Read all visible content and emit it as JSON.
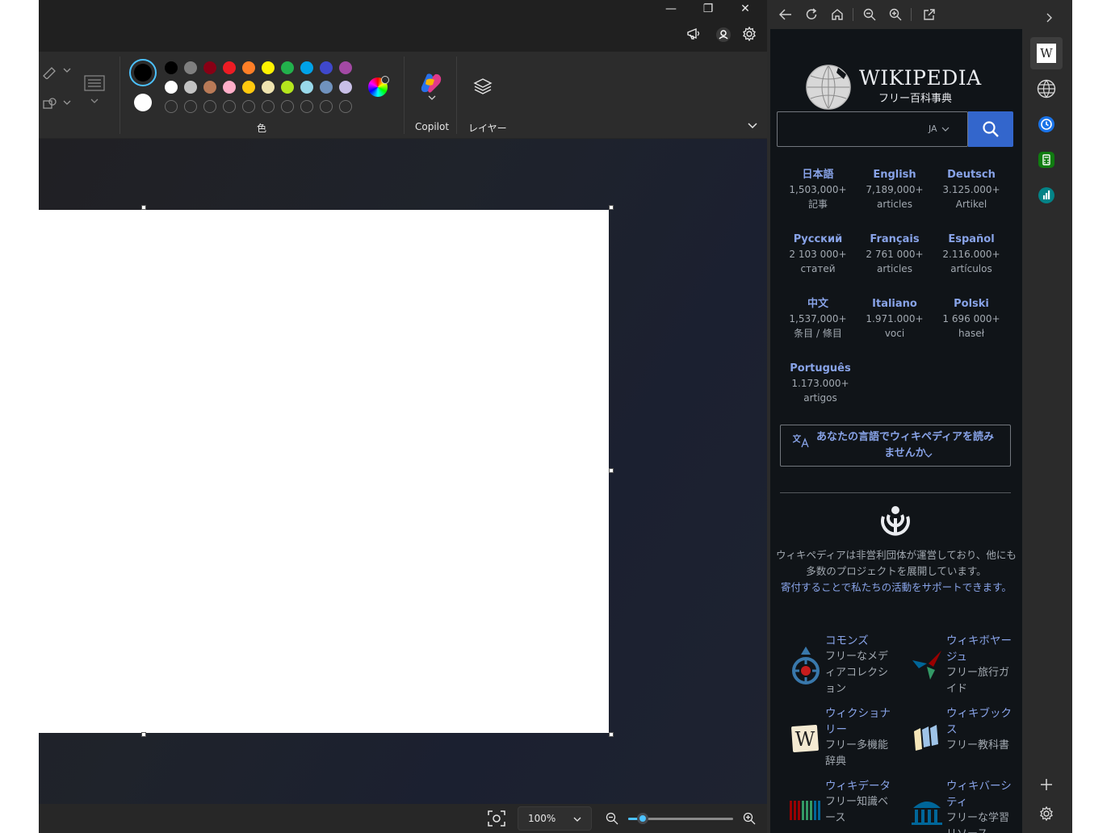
{
  "paint": {
    "window_controls": {
      "minimize": "—",
      "restore": "❐",
      "close": "✕"
    },
    "titlebar_icons": [
      "megaphone-icon",
      "account-icon",
      "settings-gear-icon"
    ],
    "palette": {
      "primary_color": "#000000",
      "secondary_color": "#ffffff",
      "row1": [
        "#000000",
        "#7f7f7f",
        "#880015",
        "#ed1c24",
        "#ff7f27",
        "#fff200",
        "#22b14c",
        "#00a2e8",
        "#3f48cc",
        "#a349a4"
      ],
      "row2": [
        "#ffffff",
        "#c3c3c3",
        "#b97a57",
        "#ffaec9",
        "#ffc90e",
        "#efe4b0",
        "#b5e61d",
        "#99d9ea",
        "#7092be",
        "#c8bfe7"
      ],
      "label": "色"
    },
    "copilot_label": "Copilot",
    "layers_label": "レイヤー",
    "status": {
      "zoom_value": "100%",
      "zoom_percent": 10
    }
  },
  "sidepanel": {
    "toolbar_icons": [
      "back-icon",
      "refresh-icon",
      "home-icon",
      "zoom-out-icon",
      "zoom-in-icon",
      "open-external-icon"
    ],
    "wiki": {
      "wordmark": "WIKIPEDIA",
      "tagline": "フリー百科事典",
      "search": {
        "placeholder": "",
        "lang_code": "JA"
      },
      "languages": [
        {
          "name": "日本語",
          "count": "1,503,000+",
          "unit": "記事"
        },
        {
          "name": "English",
          "count": "7,189,000+",
          "unit": "articles"
        },
        {
          "name": "Deutsch",
          "count": "3.125.000+",
          "unit": "Artikel"
        },
        {
          "name": "Русский",
          "count": "2 103 000+",
          "unit": "статей"
        },
        {
          "name": "Français",
          "count": "2 761 000+",
          "unit": "articles"
        },
        {
          "name": "Español",
          "count": "2.116.000+",
          "unit": "artículos"
        },
        {
          "name": "中文",
          "count": "1,537,000+",
          "unit": "条目 / 條目"
        },
        {
          "name": "Italiano",
          "count": "1.971.000+",
          "unit": "voci"
        },
        {
          "name": "Polski",
          "count": "1 696 000+",
          "unit": "haseł"
        },
        {
          "name": "Português",
          "count": "1.173.000+",
          "unit": "artigos"
        }
      ],
      "language_cta": "あなたの言語でウィキペディアを読みませんか",
      "wmf_text": "ウィキペディアは非営利団体が運営しており、他にも多数のプロジェクトを展開しています。",
      "wmf_link": "寄付することで私たちの活動をサポートできます。",
      "projects": [
        {
          "name": "コモンズ",
          "desc": "フリーなメディアコレクション",
          "icon": "commons-icon"
        },
        {
          "name": "ウィキボヤージュ",
          "desc": "フリー旅行ガイド",
          "icon": "wikivoyage-icon"
        },
        {
          "name": "ウィクショナリー",
          "desc": "フリー多機能辞典",
          "icon": "wiktionary-icon"
        },
        {
          "name": "ウィキブックス",
          "desc": "フリー教科書",
          "icon": "wikibooks-icon"
        },
        {
          "name": "ウィキデータ",
          "desc": "フリー知識ベース",
          "icon": "wikidata-icon"
        },
        {
          "name": "ウィキバーシティ",
          "desc": "フリーな学習リソース",
          "icon": "wikiversity-icon"
        }
      ]
    }
  },
  "rail": {
    "collapse_icon": "chevron-right-icon",
    "apps": [
      {
        "icon": "wikipedia-app-icon",
        "text": "W"
      },
      {
        "icon": "globe-icon"
      },
      {
        "icon": "clock-app-icon",
        "color": "#1a73e8"
      },
      {
        "icon": "calculator-app-icon",
        "color": "#107c10"
      },
      {
        "icon": "analytics-app-icon",
        "color": "#038387"
      }
    ],
    "bottom_icons": [
      "add-icon",
      "rail-settings-icon"
    ]
  }
}
